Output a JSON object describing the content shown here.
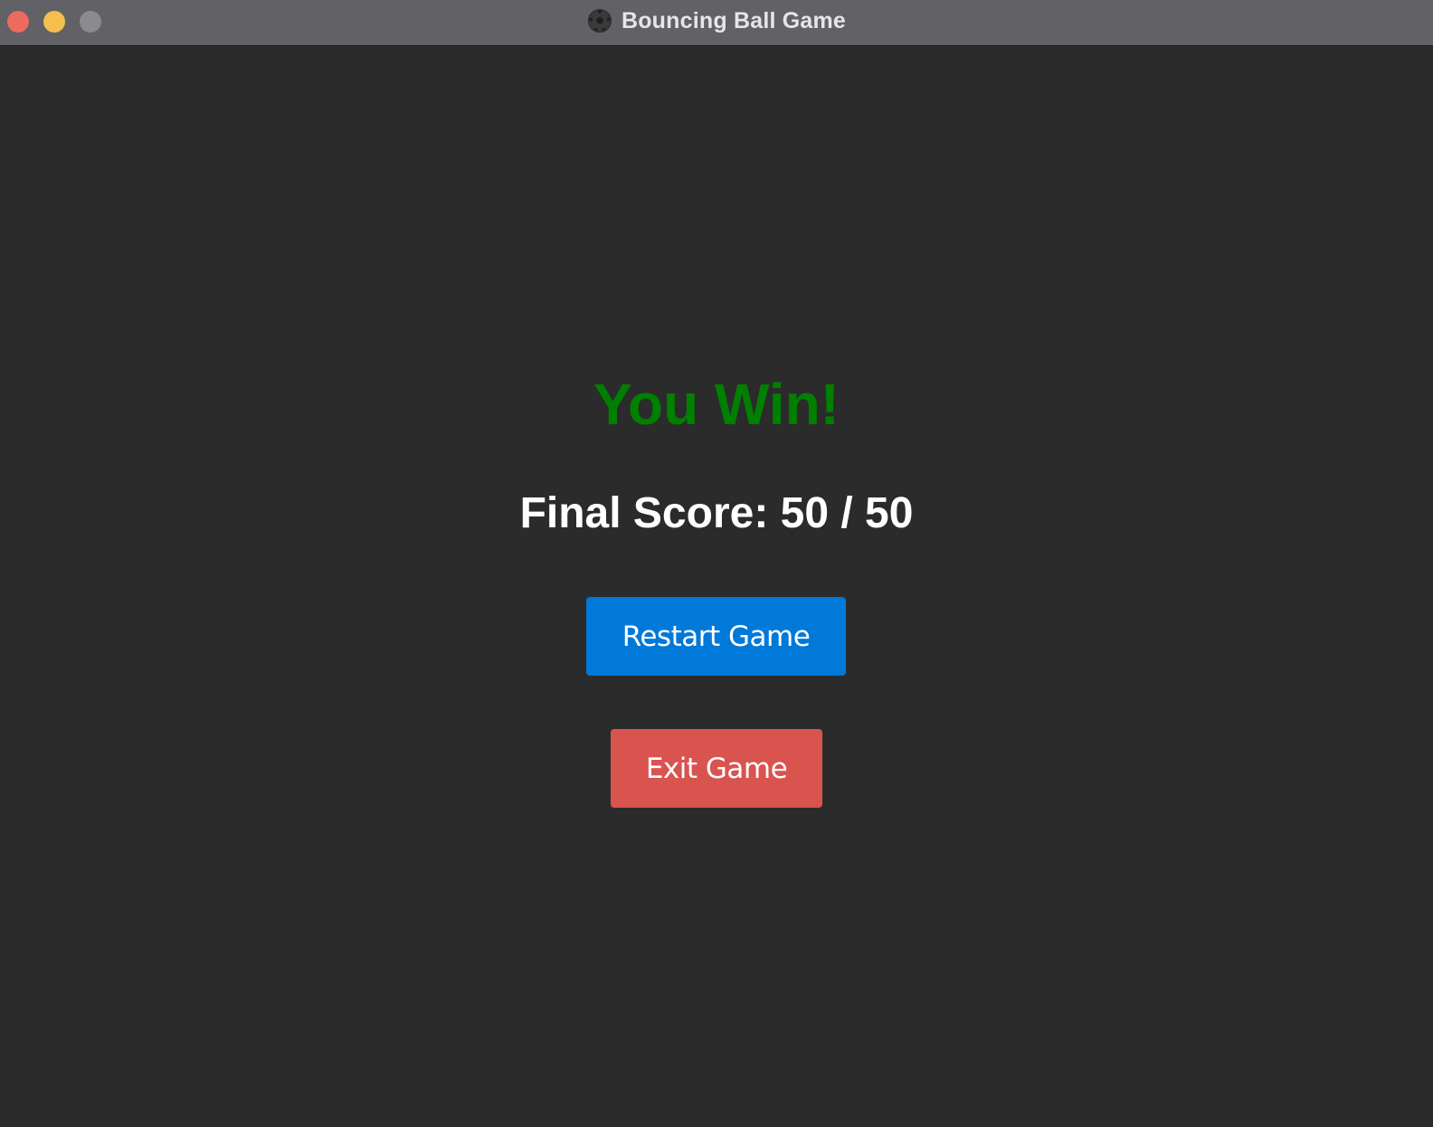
{
  "window": {
    "title": "Bouncing Ball Game",
    "icon": "soccer-ball-icon"
  },
  "colors": {
    "win_text": "#008000",
    "restart_button": "#0179d9",
    "exit_button": "#d9534f",
    "background": "#2b2b2b"
  },
  "game_over": {
    "result_text": "You Win!",
    "score_text": "Final Score: 50 / 50"
  },
  "buttons": {
    "restart_label": "Restart Game",
    "exit_label": "Exit Game"
  }
}
